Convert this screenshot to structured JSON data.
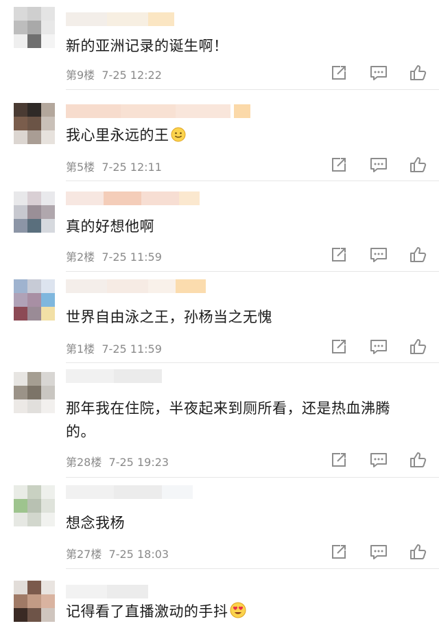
{
  "comments": [
    {
      "text": "新的亚洲记录的诞生啊！",
      "floor": "第9楼",
      "date": "7-25",
      "time": "12:22"
    },
    {
      "text": "我心里永远的王",
      "emoji": "smile-emoji",
      "floor": "第5楼",
      "date": "7-25",
      "time": "12:11"
    },
    {
      "text": "真的好想他啊",
      "floor": "第2楼",
      "date": "7-25",
      "time": "11:59"
    },
    {
      "text": "世界自由泳之王，孙杨当之无愧",
      "floor": "第1楼",
      "date": "7-25",
      "time": "11:59"
    },
    {
      "text": "那年我在住院，半夜起来到厕所看，还是热血沸腾的。",
      "floor": "第28楼",
      "date": "7-25",
      "time": "19:23"
    },
    {
      "text": "想念我杨",
      "floor": "第27楼",
      "date": "7-25",
      "time": "18:03"
    },
    {
      "text": "记得看了直播激动的手抖",
      "emoji": "heart-eyes-emoji"
    }
  ],
  "icons": {
    "share": "share-icon",
    "reply": "comment-icon",
    "like": "thumbs-up-icon"
  },
  "colors": {
    "meta_text": "#8a8a8a",
    "divider": "#e6e6e6",
    "icon": "#8c8c8c"
  }
}
